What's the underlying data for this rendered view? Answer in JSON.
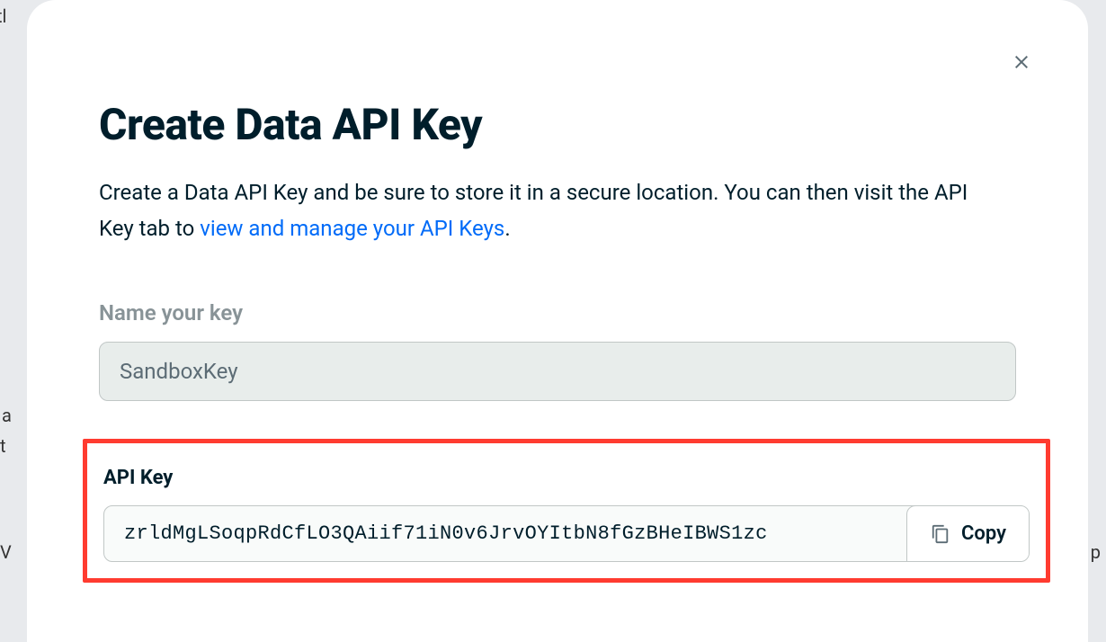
{
  "modal": {
    "title": "Create Data API Key",
    "description_pre": "Create a Data API Key and be sure to store it in a secure location. You can then visit the API Key tab to ",
    "description_link": "view and manage your API Keys",
    "description_post": ".",
    "name_label": "Name your key",
    "name_value": "SandboxKey",
    "api_key_label": "API Key",
    "api_key_value": "zrldMgLSoqpRdCfLO3QAiif71iN0v6JrvOYItbN8fGzBHeIBWS1zc",
    "copy_label": "Copy"
  }
}
